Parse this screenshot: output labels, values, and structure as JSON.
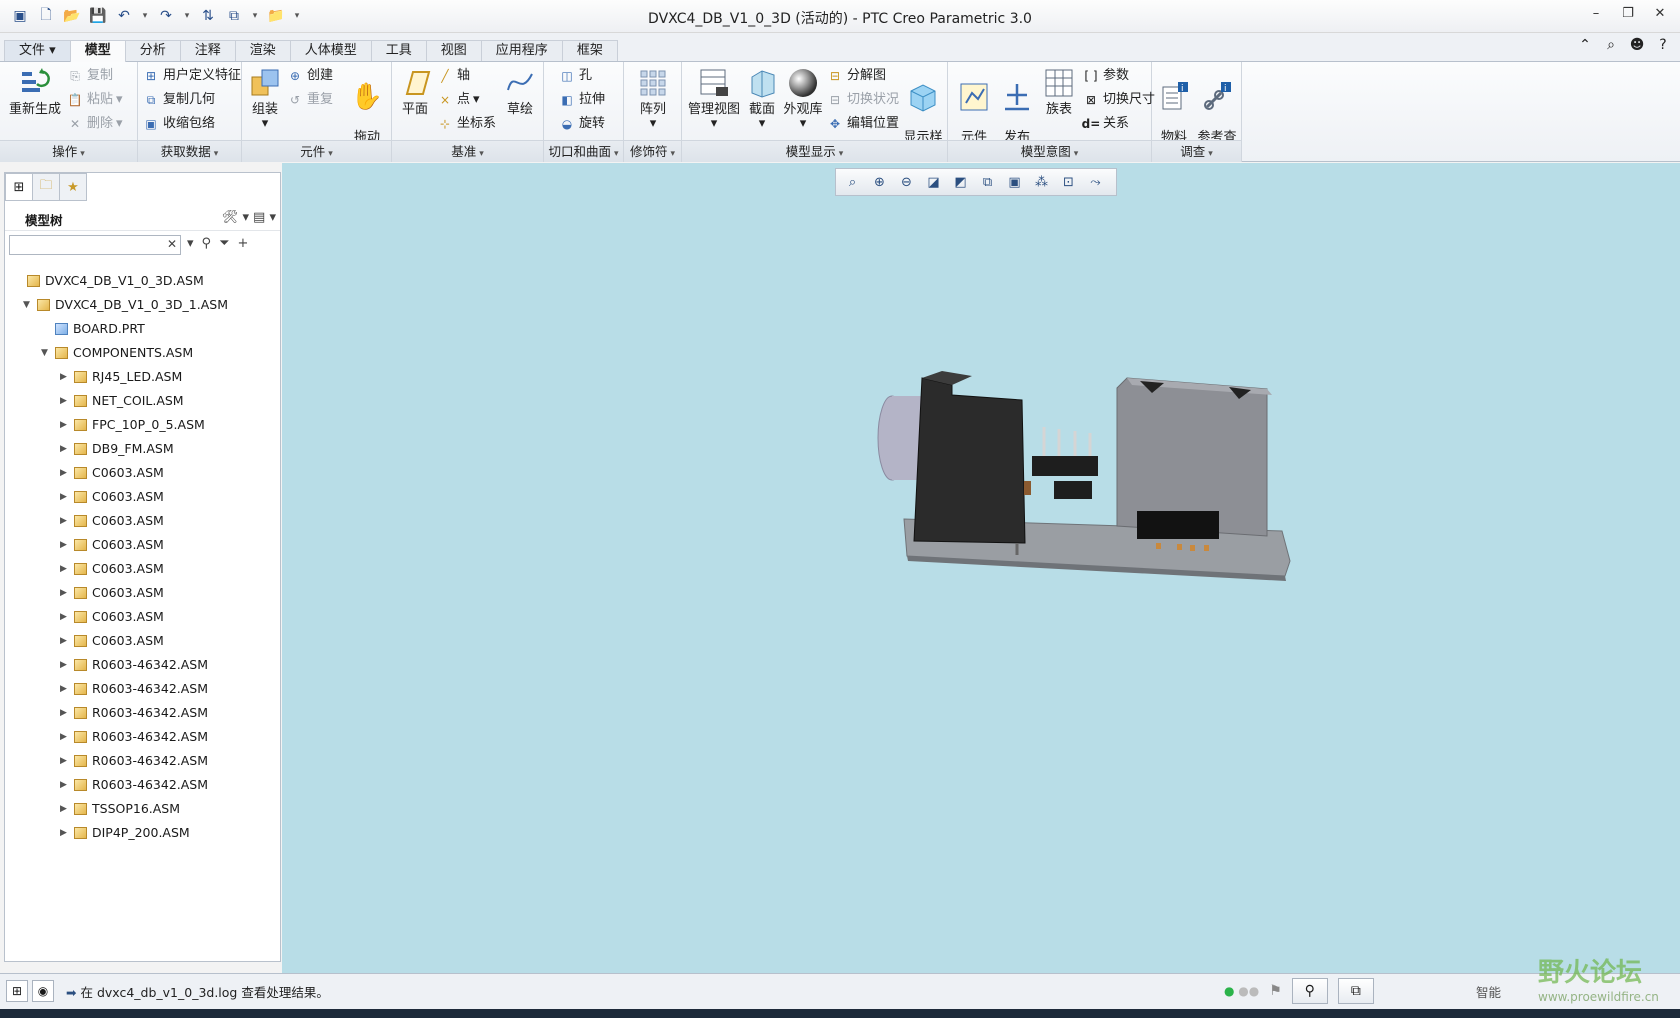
{
  "titlebar": {
    "title": "DVXC4_DB_V1_0_3D (活动的) - PTC Creo Parametric 3.0",
    "quick_access": [
      "app-icon",
      "new-icon",
      "open-icon",
      "save-icon",
      "undo-icon",
      "redo-icon",
      "regenerate-icon",
      "window-icon",
      "close-window-icon",
      "customize-icon"
    ]
  },
  "tabs": {
    "file": "文件",
    "items": [
      "模型",
      "分析",
      "注释",
      "渲染",
      "人体模型",
      "工具",
      "视图",
      "应用程序",
      "框架"
    ],
    "active": "模型"
  },
  "ribbon": {
    "operations": {
      "label": "操作",
      "regenerate": "重新生成",
      "copy": "复制",
      "paste": "粘贴",
      "delete": "删除"
    },
    "get_data": {
      "label": "获取数据",
      "udf": "用户定义特征",
      "copy_geom": "复制几何",
      "shrinkwrap": "收缩包络"
    },
    "component": {
      "label": "元件",
      "assemble": "组装",
      "create": "创建",
      "repeat": "重复",
      "drag": "拖动\n元件"
    },
    "datum": {
      "label": "基准",
      "plane": "平面",
      "axis": "轴",
      "point": "点",
      "csys": "坐标系",
      "sketch": "草绘"
    },
    "cut_surface": {
      "label": "切口和曲面",
      "hole": "孔",
      "extrude": "拉伸",
      "revolve": "旋转"
    },
    "modifiers": {
      "label": "修饰符",
      "pattern": "阵列"
    },
    "model_display": {
      "label": "模型显示",
      "manage_views": "管理视图",
      "section": "截面",
      "appearance": "外观库",
      "exploded": "分解图",
      "toggle_status": "切换状况",
      "edit_position": "编辑位置",
      "display_style": "显示样\n式"
    },
    "model_intent": {
      "label": "模型意图",
      "comp_interface": "元件\n界面",
      "publish_geom": "发布\n几何",
      "family_table": "族表",
      "params": "参数",
      "switch_dims": "切换尺寸",
      "relations": "关系"
    },
    "investigate": {
      "label": "调查",
      "bom": "物料\n清单",
      "ref_viewer": "参考查\n看器"
    }
  },
  "left_panel": {
    "title": "模型树",
    "search_placeholder": "",
    "tree": [
      {
        "label": "DVXC4_DB_V1_0_3D.ASM",
        "level": 0,
        "twisty": "",
        "type": "asm"
      },
      {
        "label": "DVXC4_DB_V1_0_3D_1.ASM",
        "level": 1,
        "twisty": "▼",
        "type": "asm"
      },
      {
        "label": "BOARD.PRT",
        "level": 2,
        "twisty": "",
        "type": "prt"
      },
      {
        "label": "COMPONENTS.ASM",
        "level": 2,
        "twisty": "▼",
        "type": "asm"
      },
      {
        "label": "RJ45_LED.ASM",
        "level": 3,
        "twisty": "▶",
        "type": "asm"
      },
      {
        "label": "NET_COIL.ASM",
        "level": 3,
        "twisty": "▶",
        "type": "asm"
      },
      {
        "label": "FPC_10P_0_5.ASM",
        "level": 3,
        "twisty": "▶",
        "type": "asm"
      },
      {
        "label": "DB9_FM.ASM",
        "level": 3,
        "twisty": "▶",
        "type": "asm"
      },
      {
        "label": "C0603.ASM",
        "level": 3,
        "twisty": "▶",
        "type": "asm"
      },
      {
        "label": "C0603.ASM",
        "level": 3,
        "twisty": "▶",
        "type": "asm"
      },
      {
        "label": "C0603.ASM",
        "level": 3,
        "twisty": "▶",
        "type": "asm"
      },
      {
        "label": "C0603.ASM",
        "level": 3,
        "twisty": "▶",
        "type": "asm"
      },
      {
        "label": "C0603.ASM",
        "level": 3,
        "twisty": "▶",
        "type": "asm"
      },
      {
        "label": "C0603.ASM",
        "level": 3,
        "twisty": "▶",
        "type": "asm"
      },
      {
        "label": "C0603.ASM",
        "level": 3,
        "twisty": "▶",
        "type": "asm"
      },
      {
        "label": "C0603.ASM",
        "level": 3,
        "twisty": "▶",
        "type": "asm"
      },
      {
        "label": "R0603-46342.ASM",
        "level": 3,
        "twisty": "▶",
        "type": "asm"
      },
      {
        "label": "R0603-46342.ASM",
        "level": 3,
        "twisty": "▶",
        "type": "asm"
      },
      {
        "label": "R0603-46342.ASM",
        "level": 3,
        "twisty": "▶",
        "type": "asm"
      },
      {
        "label": "R0603-46342.ASM",
        "level": 3,
        "twisty": "▶",
        "type": "asm"
      },
      {
        "label": "R0603-46342.ASM",
        "level": 3,
        "twisty": "▶",
        "type": "asm"
      },
      {
        "label": "R0603-46342.ASM",
        "level": 3,
        "twisty": "▶",
        "type": "asm"
      },
      {
        "label": "TSSOP16.ASM",
        "level": 3,
        "twisty": "▶",
        "type": "asm"
      },
      {
        "label": "DIP4P_200.ASM",
        "level": 3,
        "twisty": "▶",
        "type": "asm"
      }
    ]
  },
  "graphics": {
    "background": "#b8dde7",
    "view_toolbar": [
      "refit-icon",
      "zoom-in-icon",
      "zoom-out-icon",
      "repaint-icon",
      "display-style-icon",
      "saved-views-icon",
      "view-manager-icon",
      "datum-display-icon",
      "spin-center-icon",
      "annotation-display-icon"
    ]
  },
  "status": {
    "message": "在 dvxc4_db_v1_0_3d.log 查看处理结果。",
    "smart": "智能"
  },
  "watermark": {
    "text": "野火论坛",
    "url": "www.proewildfire.cn"
  }
}
